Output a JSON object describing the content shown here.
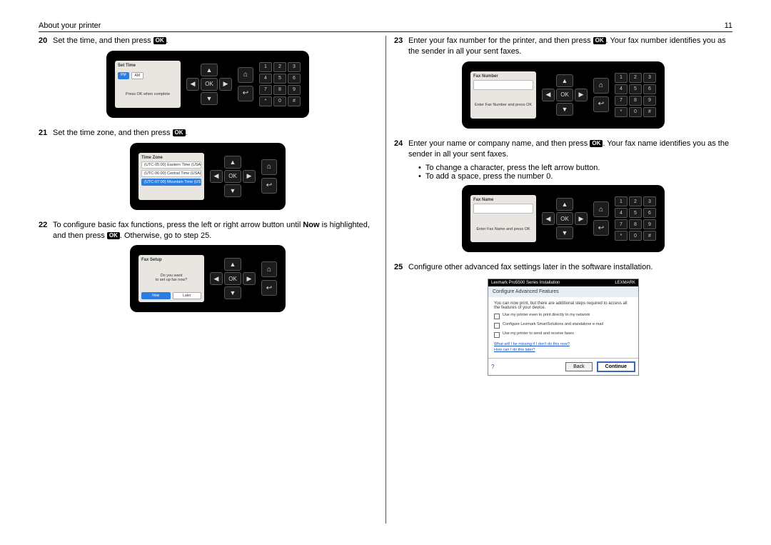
{
  "header": {
    "title": "About your printer",
    "page": "11"
  },
  "ok_label": "OK",
  "steps": {
    "s20": {
      "num": "20",
      "text_before": "Set the time, and then press ",
      "text_after": "."
    },
    "s21": {
      "num": "21",
      "text_before": "Set the time zone, and then press ",
      "text_after": "."
    },
    "s22": {
      "num": "22",
      "text_before": "To configure basic fax functions, press the left or right arrow button until ",
      "bold": "Now",
      "text_mid": " is highlighted, and then press ",
      "text_after": ". Otherwise, go to step 25."
    },
    "s23": {
      "num": "23",
      "text_before": "Enter your fax number for the printer, and then press ",
      "text_after": ". Your fax number identifies you as the sender in all your sent faxes."
    },
    "s24": {
      "num": "24",
      "text_before": "Enter your name or company name, and then press ",
      "text_after": ". Your fax name identifies you as the sender in all your sent faxes."
    },
    "s25": {
      "num": "25",
      "text": "Configure other advanced fax settings later in the software installation."
    }
  },
  "bullets_24": [
    "To change a character, press the left arrow button.",
    "To add a space, press the number 0."
  ],
  "panels": {
    "time": {
      "title": "Set Time",
      "am": "AM",
      "pm": "PM",
      "hint": "Press OK when complete"
    },
    "zone": {
      "title": "Time Zone",
      "opts": [
        "(UTC-05:00) Eastern Time (USA/Ca...",
        "(UTC-06:00) Central Time (USA/Ca...",
        "(UTC-07:00) Mountain Time (USA/C..."
      ],
      "selected": 2
    },
    "faxsetup": {
      "title": "Fax Setup",
      "msg1": "Do you want",
      "msg2": "to set up fax now?",
      "now": "Now",
      "later": "Later"
    },
    "faxnum": {
      "title": "Fax Number",
      "hint": "Enter Fax Number and press OK"
    },
    "faxname": {
      "title": "Fax Name",
      "hint": "Enter Fax Name and press OK"
    }
  },
  "keypad": [
    "1",
    "2",
    "3",
    "4",
    "5",
    "6",
    "7",
    "8",
    "9",
    "*",
    "0",
    "#"
  ],
  "dpad": {
    "up": "▲",
    "down": "▼",
    "left": "◀",
    "right": "▶",
    "ok": "OK"
  },
  "side": {
    "home": "⌂",
    "back": "↩"
  },
  "software": {
    "window": "Lexmark Pro5500 Series Installation",
    "brand": "LEXMARK",
    "heading": "Configure Advanced Features",
    "intro": "You can now print, but there are additional steps required to access all the features of your device.",
    "checks": [
      "Use my printer even to print directly to my network",
      "Configure Lexmark SmartSolutions and standalone e-mail",
      "Use my printer to send and receive faxes"
    ],
    "link1": "What will I be missing if I don't do this now?",
    "link2": "How can I do this later?",
    "help": "?",
    "back": "Back",
    "continue": "Continue"
  }
}
